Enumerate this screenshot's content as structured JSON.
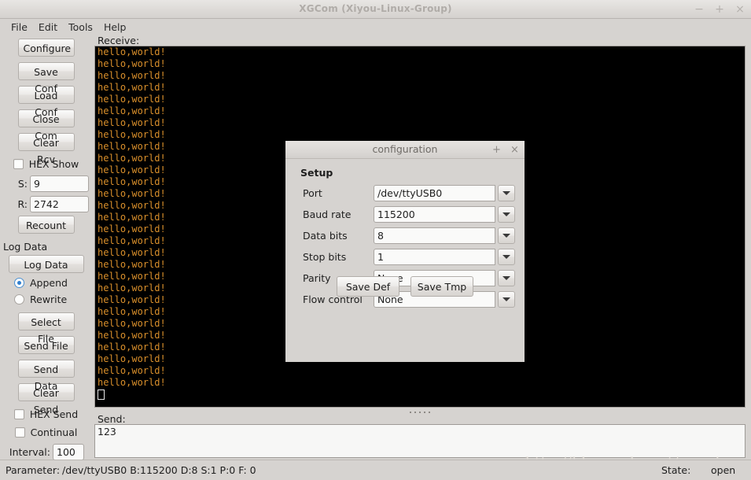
{
  "window": {
    "title": "XGCom (Xiyou-Linux-Group)",
    "controls": [
      {
        "name": "minimize-button",
        "glyph": "−"
      },
      {
        "name": "maximize-button",
        "glyph": "+"
      },
      {
        "name": "close-button",
        "glyph": "×"
      }
    ]
  },
  "menubar": {
    "items": [
      {
        "label": "File"
      },
      {
        "label": "Edit"
      },
      {
        "label": "Tools"
      },
      {
        "label": "Help"
      }
    ]
  },
  "sidebar": {
    "buttons_top": [
      {
        "label": "Configure",
        "name": "configure-button"
      },
      {
        "label": "Save Conf",
        "name": "save-conf-button"
      },
      {
        "label": "Load Conf",
        "name": "load-conf-button"
      },
      {
        "label": "Close Com",
        "name": "close-com-button"
      },
      {
        "label": "Clear Rcv",
        "name": "clear-rcv-button"
      }
    ],
    "hex_show": {
      "label": "HEX Show",
      "checked": false
    },
    "counters": [
      {
        "label": "S:",
        "value": "9",
        "name": "sent-count-field"
      },
      {
        "label": "R:",
        "value": "2742",
        "name": "recv-count-field"
      }
    ],
    "recount": {
      "label": "Recount"
    },
    "log_group_label": "Log Data",
    "log_data_button": {
      "label": "Log Data"
    },
    "log_mode": {
      "options": [
        {
          "label": "Append",
          "selected": true
        },
        {
          "label": "Rewrite",
          "selected": false
        }
      ]
    },
    "buttons_bottom": [
      {
        "label": "Select File",
        "name": "select-file-button"
      },
      {
        "label": "Send File",
        "name": "send-file-button"
      },
      {
        "label": "Send Data",
        "name": "send-data-button"
      },
      {
        "label": "Clear Send",
        "name": "clear-send-button"
      }
    ],
    "hex_send": {
      "label": "HEX Send",
      "checked": false
    },
    "continual": {
      "label": "Continual",
      "checked": false
    },
    "interval": {
      "label": "Interval:",
      "value": "100"
    }
  },
  "receive": {
    "label": "Receive:",
    "line_text": "hello,world!",
    "line_count": 29,
    "text_color": "#d98f2b",
    "background": "#000000"
  },
  "send": {
    "label": "Send:",
    "value": "123"
  },
  "statusbar": {
    "parameter_label": "Parameter:",
    "parameter_value": "/dev/ttyUSB0 B:115200 D:8 S:1 P:0 F: 0",
    "state_label": "State:",
    "state_value": "open",
    "watermark": "http://blog.csdn.net/ouening"
  },
  "dialog": {
    "title": "configuration",
    "controls": [
      {
        "name": "dialog-maximize-button",
        "glyph": "+"
      },
      {
        "name": "dialog-close-button",
        "glyph": "×"
      }
    ],
    "section_title": "Setup",
    "fields": [
      {
        "label": "Port",
        "value": "/dev/ttyUSB0",
        "name": "port"
      },
      {
        "label": "Baud rate",
        "value": "115200",
        "name": "baud-rate"
      },
      {
        "label": "Data bits",
        "value": "8",
        "name": "data-bits"
      },
      {
        "label": "Stop bits",
        "value": "1",
        "name": "stop-bits"
      },
      {
        "label": "Parity",
        "value": "None",
        "name": "parity"
      },
      {
        "label": "Flow control",
        "value": "None",
        "name": "flow-control"
      }
    ],
    "buttons": [
      {
        "label": "Save Def",
        "name": "save-def-button"
      },
      {
        "label": "Save Tmp",
        "name": "save-tmp-button"
      }
    ]
  }
}
